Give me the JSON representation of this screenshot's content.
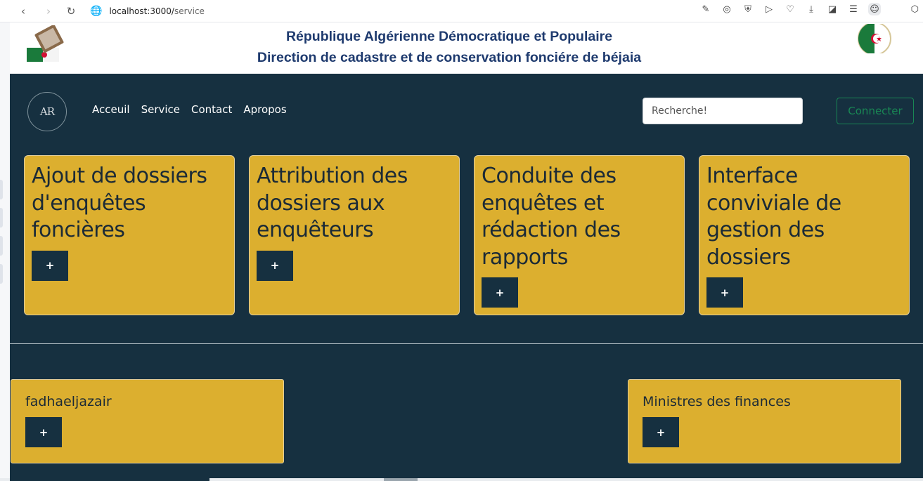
{
  "browser": {
    "url_host": "localhost:3000/",
    "url_path": "service"
  },
  "header": {
    "line1": "République Algérienne Démocratique et Populaire",
    "line2": "Direction de cadastre et de conservation fonciére de béjaia"
  },
  "navbar": {
    "brand": "AR",
    "links": [
      "Acceuil",
      "Service",
      "Contact",
      "Apropos"
    ],
    "search_placeholder": "Recherche!",
    "connect_label": "Connecter"
  },
  "cards": [
    {
      "title": "Ajout de dossiers d'enquêtes foncières",
      "button": "+"
    },
    {
      "title": "Attribution des dossiers aux enquêteurs",
      "button": "+"
    },
    {
      "title": "Conduite des enquêtes et rédaction des rapports",
      "button": "+"
    },
    {
      "title": "Interface conviviale de gestion des dossiers",
      "button": "+"
    }
  ],
  "partners": [
    {
      "title": "fadhaeljazair",
      "button": "+"
    },
    {
      "title": "Ministres des finances",
      "button": "+"
    }
  ],
  "colors": {
    "navy": "#163040",
    "gold": "#dcaf2f",
    "header_text": "#1e3a6e",
    "connect_green": "#198754"
  }
}
